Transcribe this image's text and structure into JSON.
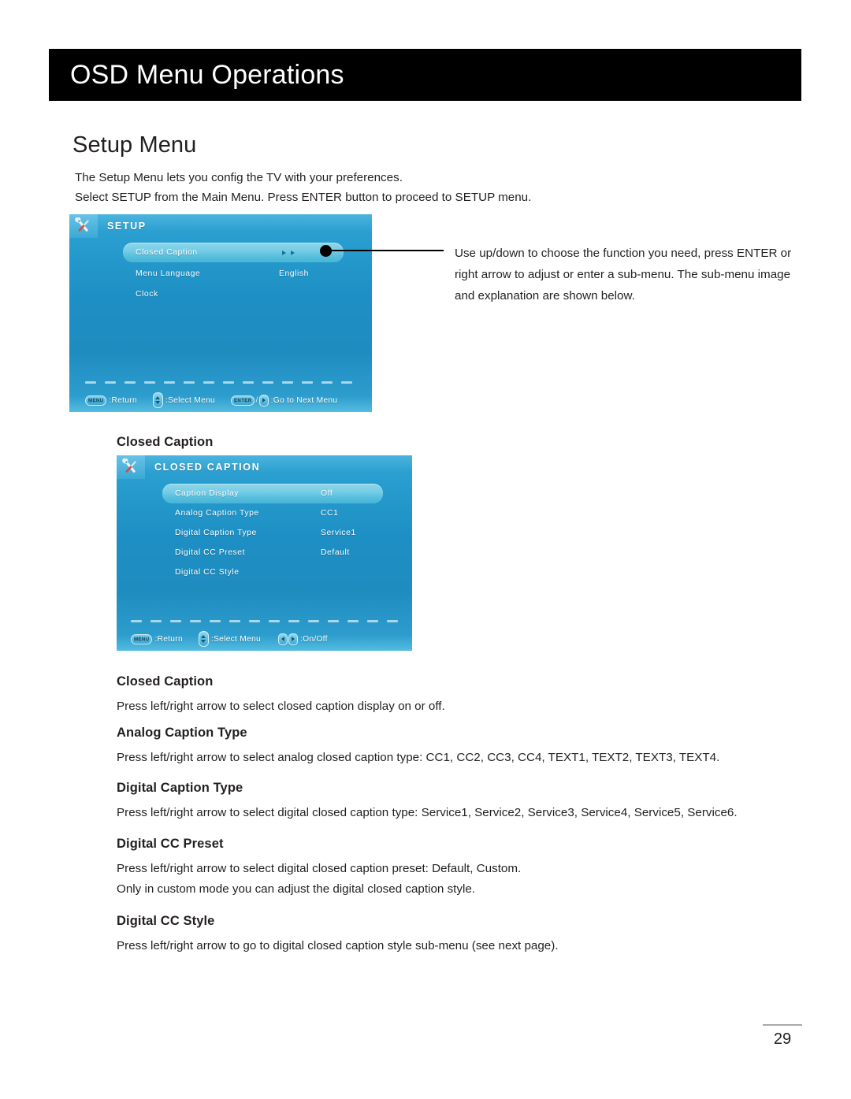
{
  "header": {
    "title": "OSD Menu Operations"
  },
  "section": {
    "title": "Setup Menu",
    "intro_line1": "The Setup Menu lets you config the TV with your preferences.",
    "intro_line2": "Select SETUP from the Main Menu. Press ENTER button to proceed to SETUP menu."
  },
  "setup_osd": {
    "icon": "tools-icon",
    "title": "SETUP",
    "rows": [
      {
        "label": "Closed Caption",
        "value": "",
        "selected": true,
        "has_arrows": true
      },
      {
        "label": "Menu Language",
        "value": "English",
        "selected": false,
        "has_arrows": false
      },
      {
        "label": "Clock",
        "value": "",
        "selected": false,
        "has_arrows": false
      }
    ],
    "hints": [
      {
        "key": "MENU",
        "key_type": "text",
        "text": ":Return"
      },
      {
        "key": "",
        "key_type": "updown",
        "text": ":Select Menu"
      },
      {
        "key": "ENTER",
        "key_type": "enter-right",
        "text": ":Go to Next Menu"
      }
    ]
  },
  "callout": {
    "text": "Use up/down to choose the function you need, press ENTER or right arrow to adjust or enter a sub-menu. The sub-menu image and explanation are shown below."
  },
  "cc_heading": "Closed Caption",
  "cc_osd": {
    "icon": "tools-icon",
    "title": "CLOSED CAPTION",
    "rows": [
      {
        "label": "Caption Display",
        "value": "Off",
        "selected": true
      },
      {
        "label": "Analog Caption Type",
        "value": "CC1",
        "selected": false
      },
      {
        "label": "Digital Caption Type",
        "value": "Service1",
        "selected": false
      },
      {
        "label": "Digital CC Preset",
        "value": "Default",
        "selected": false
      },
      {
        "label": "Digital CC Style",
        "value": "",
        "selected": false
      }
    ],
    "hints": [
      {
        "key": "MENU",
        "key_type": "text",
        "text": ":Return"
      },
      {
        "key": "",
        "key_type": "updown",
        "text": ":Select Menu"
      },
      {
        "key": "",
        "key_type": "leftright",
        "text": ":On/Off"
      }
    ]
  },
  "sections": [
    {
      "heading": "Closed Caption",
      "paragraphs": [
        "Press left/right arrow to select closed caption display on or off."
      ]
    },
    {
      "heading": "Analog Caption Type",
      "paragraphs": [
        "Press left/right arrow to select analog closed caption type: CC1, CC2, CC3, CC4, TEXT1, TEXT2, TEXT3, TEXT4."
      ]
    },
    {
      "heading": "Digital Caption Type",
      "paragraphs": [
        "Press left/right arrow to select digital closed caption type: Service1, Service2, Service3, Service4, Service5, Service6."
      ]
    },
    {
      "heading": "Digital CC Preset",
      "paragraphs": [
        "Press left/right arrow to select digital closed caption preset: Default, Custom.",
        "Only in custom mode you can adjust the digital closed caption style."
      ]
    },
    {
      "heading": "Digital CC Style",
      "paragraphs": [
        "Press left/right arrow to go to digital closed caption style sub-menu (see next page)."
      ]
    }
  ],
  "footer": {
    "page_number": "29"
  },
  "colors": {
    "osd_blue_top": "#4bb4dd",
    "osd_blue_mid": "#1d8fc4",
    "osd_highlight": "#76cde6",
    "header_black": "#000000",
    "text": "#231f20",
    "rule_gray": "#a7a9ac"
  }
}
